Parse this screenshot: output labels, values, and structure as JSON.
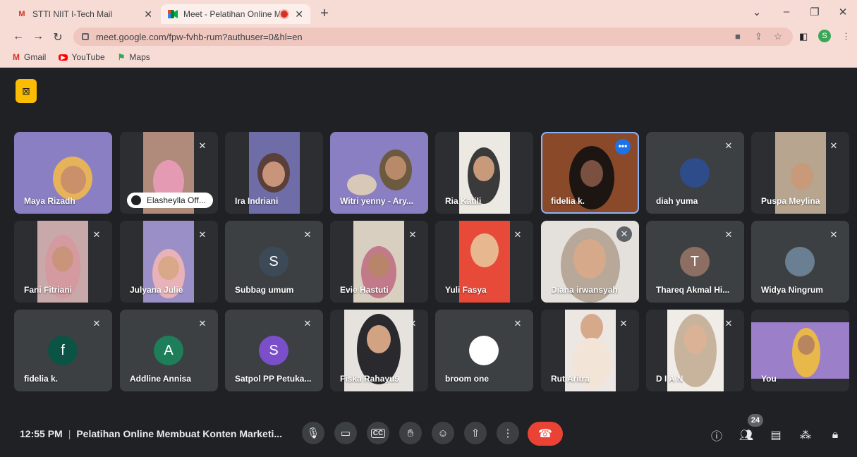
{
  "browser": {
    "tabs": [
      {
        "title": "STTI NIIT I-Tech Mail",
        "icon": "gmail-icon",
        "active": false
      },
      {
        "title": "Meet - Pelatihan Online Mem",
        "icon": "meet-icon",
        "active": true,
        "recording": true
      }
    ],
    "url": "meet.google.com/fpw-fvhb-rum?authuser=0&hl=en",
    "profile_initial": "S",
    "bookmarks": [
      {
        "label": "Gmail",
        "icon": "gmail-icon"
      },
      {
        "label": "YouTube",
        "icon": "youtube-icon"
      },
      {
        "label": "Maps",
        "icon": "maps-icon"
      }
    ]
  },
  "participants": [
    {
      "name": "Maya Rizadh",
      "type": "video",
      "muted": false
    },
    {
      "name": "Elasheylla Off...",
      "type": "video",
      "muted": true,
      "pill": true
    },
    {
      "name": "Ira Indriani",
      "type": "video",
      "muted": false
    },
    {
      "name": "Witri yenny - Ary...",
      "type": "video",
      "muted": false
    },
    {
      "name": "Ria Katili",
      "type": "video",
      "muted": false
    },
    {
      "name": "fidelia k.",
      "type": "video",
      "muted": false,
      "speaking": true
    },
    {
      "name": "diah yuma",
      "type": "image-avatar",
      "muted": true
    },
    {
      "name": "Puspa Meylina",
      "type": "video",
      "muted": true
    },
    {
      "name": "Fani Fitriani",
      "type": "video",
      "muted": true
    },
    {
      "name": "Julyana Julie",
      "type": "video",
      "muted": true
    },
    {
      "name": "Subbag umum",
      "type": "letter",
      "initial": "S",
      "color": "#3c4a57",
      "muted": true
    },
    {
      "name": "Evie Hastuti",
      "type": "video",
      "muted": true
    },
    {
      "name": "Yuli Fasya",
      "type": "video",
      "muted": true
    },
    {
      "name": "Diana irwansyah",
      "type": "video",
      "muted": true
    },
    {
      "name": "Thareq Akmal Hi...",
      "type": "letter",
      "initial": "T",
      "color": "#8d6e63",
      "muted": true
    },
    {
      "name": "Widya Ningrum",
      "type": "image-avatar",
      "muted": true
    },
    {
      "name": "fidelia k.",
      "type": "letter",
      "initial": "f",
      "color": "#0b5345",
      "muted": true
    },
    {
      "name": "Addline Annisa",
      "type": "letter",
      "initial": "A",
      "color": "#1e7e5a",
      "muted": true
    },
    {
      "name": "Satpol PP Petuka...",
      "type": "letter",
      "initial": "S",
      "color": "#7b4fc9",
      "muted": true
    },
    {
      "name": "Fiska Rahayu9",
      "type": "video",
      "muted": true
    },
    {
      "name": "broom one",
      "type": "letter",
      "initial": "",
      "color": "#ffffff",
      "muted": true
    },
    {
      "name": "Rut Aritra",
      "type": "video",
      "muted": true
    },
    {
      "name": "D I A N",
      "type": "video",
      "muted": true
    },
    {
      "name": "You",
      "type": "video",
      "muted": false
    }
  ],
  "meeting": {
    "time": "12:55 PM",
    "title": "Pelatihan Online Membuat Konten Marketi...",
    "participant_count": "24"
  }
}
